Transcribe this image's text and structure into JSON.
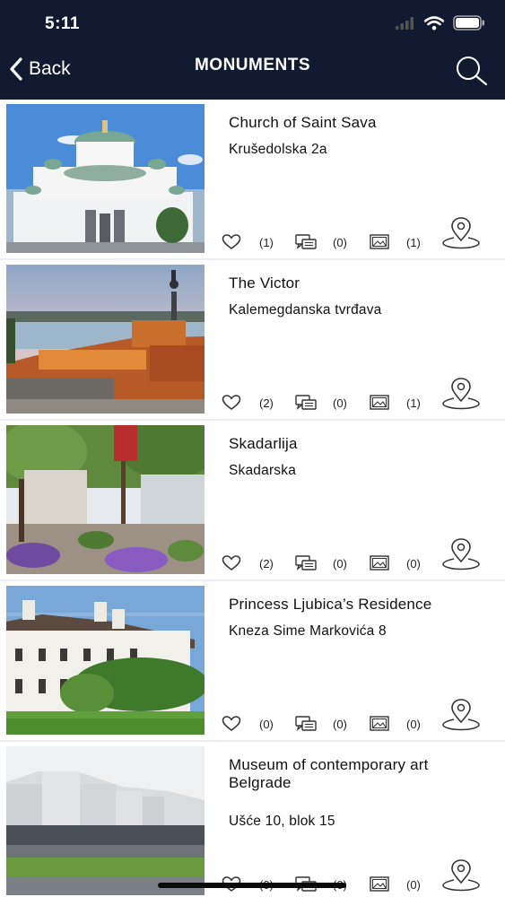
{
  "status_bar": {
    "time": "5:11"
  },
  "nav": {
    "back_label": "Back",
    "title": "MONUMENTS"
  },
  "colors": {
    "header_bg": "#121a31",
    "divider": "#eceef2",
    "icon_stroke": "#333333"
  },
  "monuments": [
    {
      "title": "Church of Saint Sava",
      "address": "Krušedolska 2a",
      "likes": "(1)",
      "comments": "(0)",
      "photos": "(1)",
      "image": "church-photo"
    },
    {
      "title": "The Victor",
      "address": "Kalemegdanska tvrđava",
      "likes": "(2)",
      "comments": "(0)",
      "photos": "(1)",
      "image": "fortress-photo"
    },
    {
      "title": "Skadarlija",
      "address": "Skadarska",
      "likes": "(2)",
      "comments": "(0)",
      "photos": "(0)",
      "image": "street-photo"
    },
    {
      "title": "Princess Ljubica’s Residence",
      "address": "Kneza Sime Markovića 8",
      "likes": "(0)",
      "comments": "(0)",
      "photos": "(0)",
      "image": "residence-photo"
    },
    {
      "title": "Museum of contemporary art Belgrade",
      "address": "Ušće 10, blok 15",
      "likes": "(0)",
      "comments": "(0)",
      "photos": "(0)",
      "image": "museum-photo"
    }
  ]
}
